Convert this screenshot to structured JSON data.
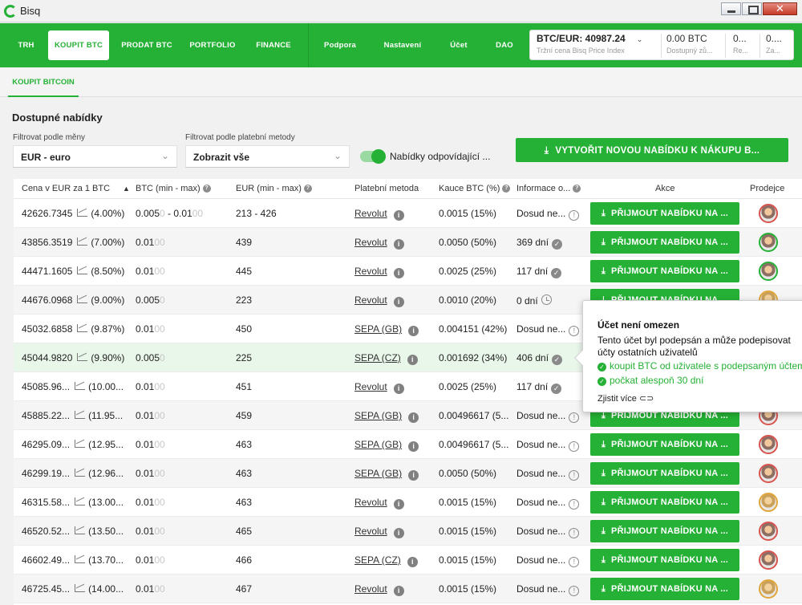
{
  "window": {
    "title": "Bisq"
  },
  "nav": {
    "items": [
      "TRH",
      "KOUPIT BTC",
      "PRODAT BTC",
      "PORTFOLIO",
      "FINANCE",
      "Podpora",
      "Nastavení",
      "Účet",
      "DAO"
    ],
    "price_value": "BTC/EUR: 40987.24",
    "price_label": "Tržní cena Bisq Price Index",
    "available_value": "0.00 BTC",
    "available_label": "Dostupný zů...",
    "reserved_value": "0...",
    "reserved_label": "Re...",
    "locked_value": "0....",
    "locked_label": "Za..."
  },
  "subtab": {
    "label": "KOUPIT BITCOIN"
  },
  "offers": {
    "title": "Dostupné nabídky",
    "currency_label": "Filtrovat podle měny",
    "currency_value": "EUR  -  euro",
    "method_label": "Filtrovat podle platební metody",
    "method_value": "Zobrazit vše",
    "toggle_label": "Nabídky odpovídající ...",
    "create_button": "VYTVOŘIT NOVOU NABÍDKU K NÁKUPU B..."
  },
  "table": {
    "headers": {
      "price": "Cena v EUR za 1 BTC",
      "amount": "BTC (min - max)",
      "volume": "EUR (min - max)",
      "method": "Platební metoda",
      "deposit": "Kauce BTC (%)",
      "info": "Informace o...",
      "action": "Akce",
      "maker": "Prodejce"
    },
    "accept_label": "PŘIJMOUT NABÍDKU NA ...",
    "rows": [
      {
        "price": "42626.7345",
        "pct": "(4.00%)",
        "amt": "0.005",
        "amt_faint": "0",
        "amt_max": " - 0.01",
        "amt_max_faint": "00",
        "vol": "213 - 426",
        "method": "Revolut",
        "deposit": "0.0015 (15%)",
        "info": "Dosud ne...",
        "icon": "warn",
        "avatar": "r"
      },
      {
        "price": "43856.3519",
        "pct": "(7.00%)",
        "amt": "0.01",
        "amt_faint": "00",
        "amt_max": "",
        "amt_max_faint": "",
        "vol": "439",
        "method": "Revolut",
        "deposit": "0.0050 (50%)",
        "info": "369 dní",
        "icon": "ok",
        "avatar": "g"
      },
      {
        "price": "44471.1605",
        "pct": "(8.50%)",
        "amt": "0.01",
        "amt_faint": "00",
        "amt_max": "",
        "amt_max_faint": "",
        "vol": "445",
        "method": "Revolut",
        "deposit": "0.0025 (25%)",
        "info": "117 dní",
        "icon": "ok",
        "avatar": "g"
      },
      {
        "price": "44676.0968",
        "pct": "(9.00%)",
        "amt": "0.005",
        "amt_faint": "0",
        "amt_max": "",
        "amt_max_faint": "",
        "vol": "223",
        "method": "Revolut",
        "deposit": "0.0010 (20%)",
        "info": "0 dní",
        "icon": "clock",
        "avatar": "y"
      },
      {
        "price": "45032.6858",
        "pct": "(9.87%)",
        "amt": "0.01",
        "amt_faint": "00",
        "amt_max": "",
        "amt_max_faint": "",
        "vol": "450",
        "method": "SEPA (GB)",
        "deposit": "0.004151 (42%)",
        "info": "Dosud ne...",
        "icon": "warn",
        "avatar": "r"
      },
      {
        "price": "45044.9820",
        "pct": "(9.90%)",
        "amt": "0.005",
        "amt_faint": "0",
        "amt_max": "",
        "amt_max_faint": "",
        "vol": "225",
        "method": "SEPA (CZ)",
        "deposit": "0.001692 (34%)",
        "info": "406 dní",
        "icon": "ok",
        "avatar": "r"
      },
      {
        "price": "45085.96...",
        "pct": "(10.00...",
        "amt": "0.01",
        "amt_faint": "00",
        "amt_max": "",
        "amt_max_faint": "",
        "vol": "451",
        "method": "Revolut",
        "deposit": "0.0025 (25%)",
        "info": "117 dní",
        "icon": "ok",
        "avatar": "r"
      },
      {
        "price": "45885.22...",
        "pct": "(11.95...",
        "amt": "0.01",
        "amt_faint": "00",
        "amt_max": "",
        "amt_max_faint": "",
        "vol": "459",
        "method": "SEPA (GB)",
        "deposit": "0.00496617 (5...",
        "info": "Dosud ne...",
        "icon": "warn",
        "avatar": "r"
      },
      {
        "price": "46295.09...",
        "pct": "(12.95...",
        "amt": "0.01",
        "amt_faint": "00",
        "amt_max": "",
        "amt_max_faint": "",
        "vol": "463",
        "method": "SEPA (GB)",
        "deposit": "0.00496617 (5...",
        "info": "Dosud ne...",
        "icon": "warn",
        "avatar": "r"
      },
      {
        "price": "46299.19...",
        "pct": "(12.96...",
        "amt": "0.01",
        "amt_faint": "00",
        "amt_max": "",
        "amt_max_faint": "",
        "vol": "463",
        "method": "SEPA (GB)",
        "deposit": "0.0050 (50%)",
        "info": "Dosud ne...",
        "icon": "warn",
        "avatar": "r"
      },
      {
        "price": "46315.58...",
        "pct": "(13.00...",
        "amt": "0.01",
        "amt_faint": "00",
        "amt_max": "",
        "amt_max_faint": "",
        "vol": "463",
        "method": "Revolut",
        "deposit": "0.0015 (15%)",
        "info": "Dosud ne...",
        "icon": "warn",
        "avatar": "y"
      },
      {
        "price": "46520.52...",
        "pct": "(13.50...",
        "amt": "0.01",
        "amt_faint": "00",
        "amt_max": "",
        "amt_max_faint": "",
        "vol": "465",
        "method": "Revolut",
        "deposit": "0.0015 (15%)",
        "info": "Dosud ne...",
        "icon": "warn",
        "avatar": "r"
      },
      {
        "price": "46602.49...",
        "pct": "(13.70...",
        "amt": "0.01",
        "amt_faint": "00",
        "amt_max": "",
        "amt_max_faint": "",
        "vol": "466",
        "method": "SEPA (CZ)",
        "deposit": "0.0015 (15%)",
        "info": "Dosud ne...",
        "icon": "warn",
        "avatar": "r"
      },
      {
        "price": "46725.45...",
        "pct": "(14.00...",
        "amt": "0.01",
        "amt_faint": "00",
        "amt_max": "",
        "amt_max_faint": "",
        "vol": "467",
        "method": "Revolut",
        "deposit": "0.0015 (15%)",
        "info": "Dosud ne...",
        "icon": "warn",
        "avatar": "y"
      }
    ]
  },
  "popup": {
    "title": "Účet není omezen",
    "description": "Tento účet byl podepsán a může podepisovat účty ostatních uživatelů",
    "items": [
      "koupit BTC od uživatele s podepsaným účtem",
      "počkat alespoň 30 dní"
    ],
    "link": "Zjistit více"
  },
  "colors": {
    "brand": "#25b135",
    "selected_row": "#e9f6ea"
  }
}
